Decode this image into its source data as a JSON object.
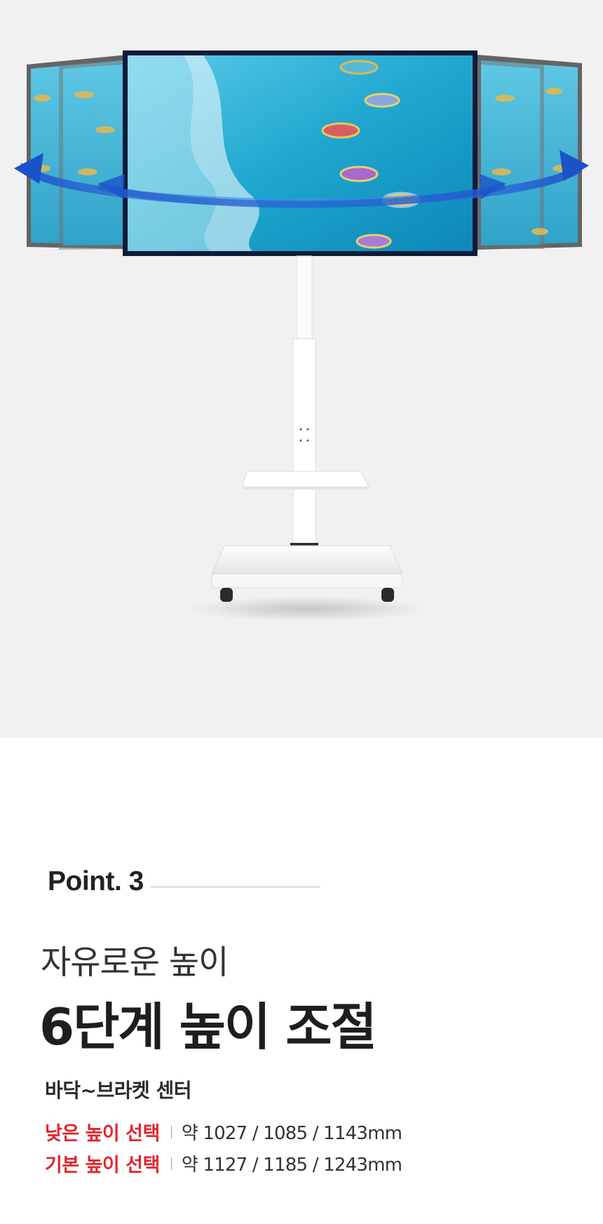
{
  "hero": {
    "background": "#f1f1f1",
    "screen_color": "#1fa7cf",
    "arrow_color": "#1f5fd6"
  },
  "point": {
    "label": "Point. 3"
  },
  "headline": {
    "subtitle": "자유로운 높이",
    "title": "6단계 높이 조절"
  },
  "spec": {
    "heading": "바닥~브라켓 센터",
    "accent_color": "#e2262b",
    "rows": [
      {
        "label": "낮은 높이 선택",
        "value": "약 1027 / 1085 / 1143mm"
      },
      {
        "label": "기본 높이 선택",
        "value": "약 1127 / 1185 / 1243mm"
      }
    ]
  }
}
